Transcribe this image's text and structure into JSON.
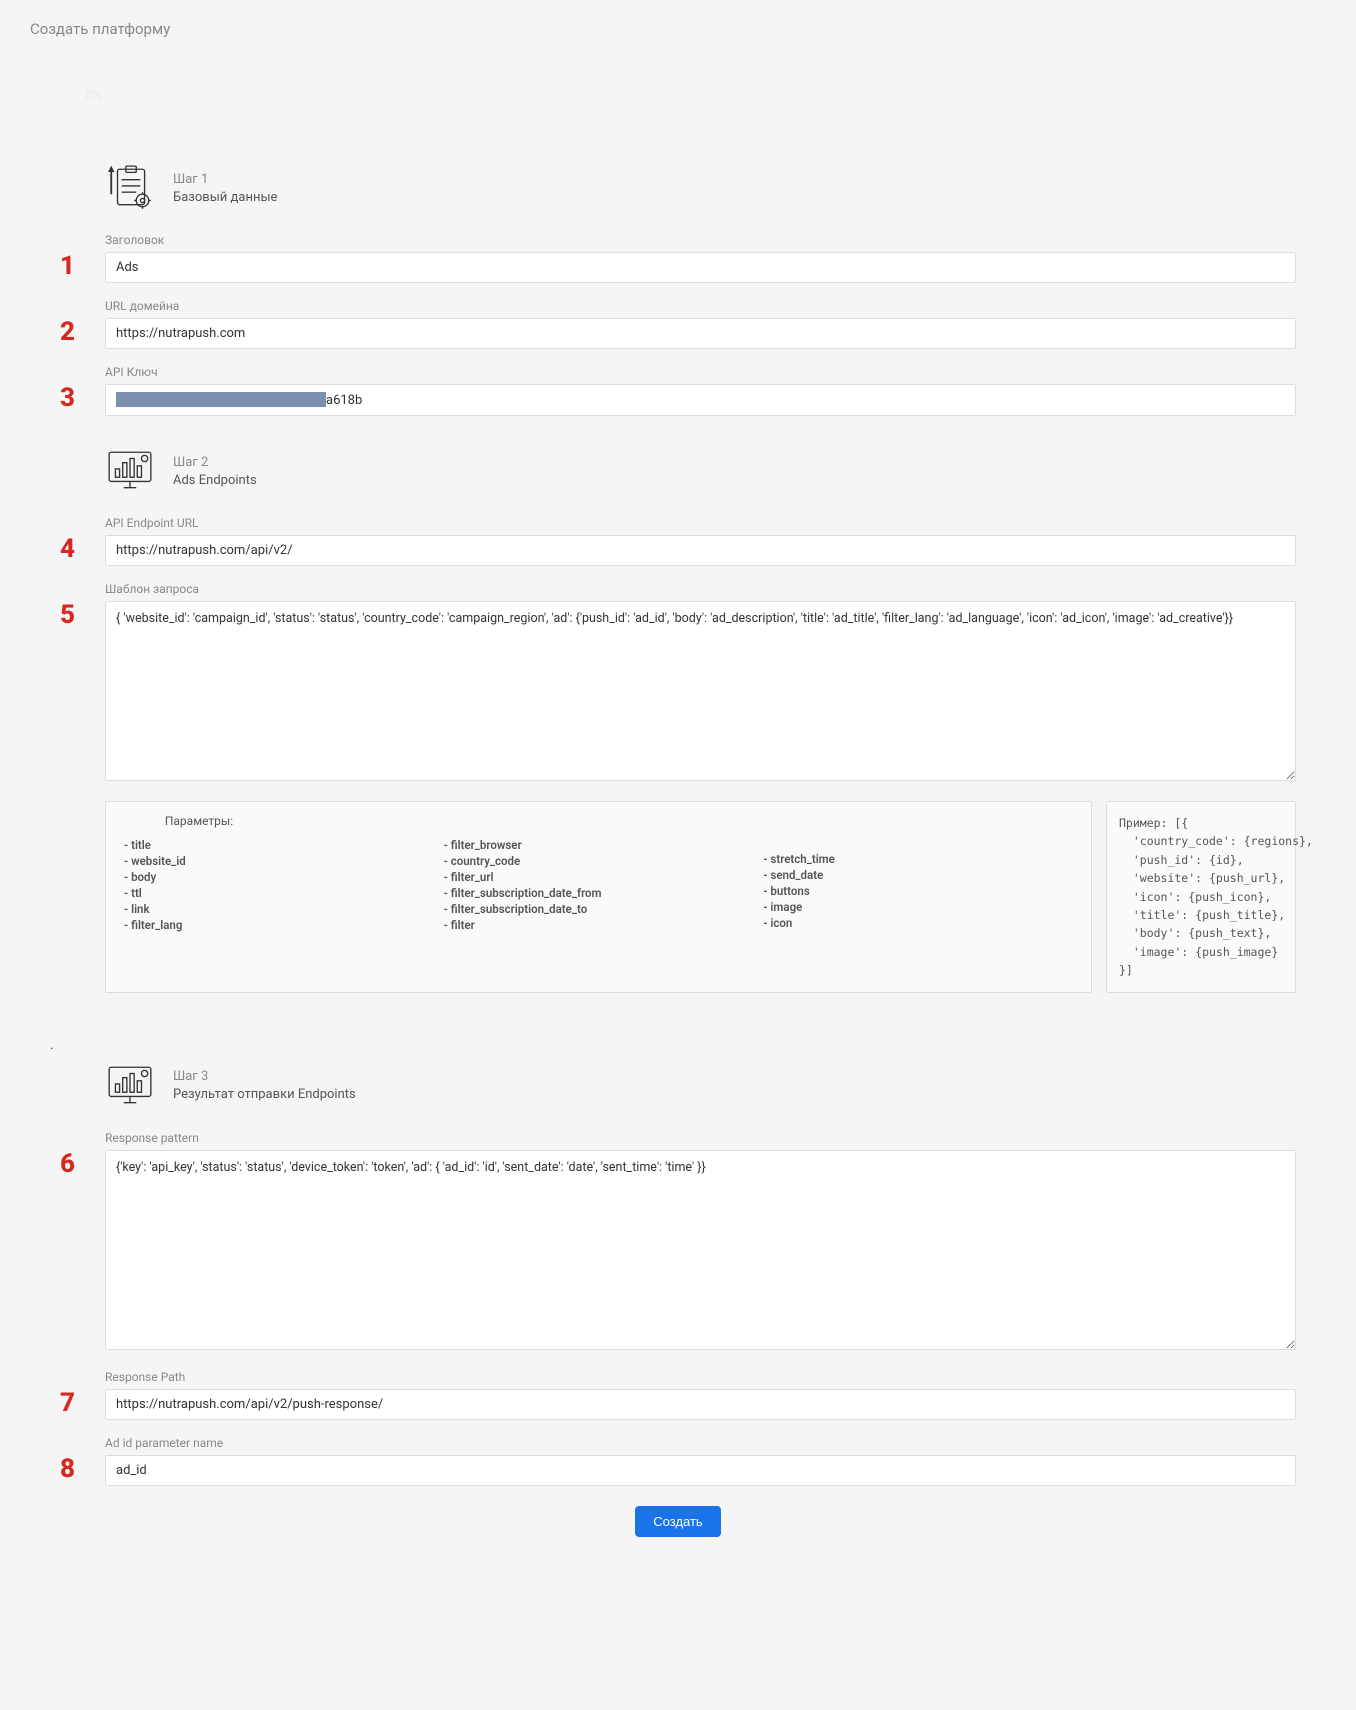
{
  "page_title": "Создать платформу",
  "progress": "0%",
  "step1": {
    "num": "Шаг 1",
    "name": "Базовый данные",
    "field1_label": "Заголовок",
    "field1_value": "Ads",
    "field2_label": "URL домейна",
    "field2_value": "https://nutrapush.com",
    "field3_label": "API Ключ",
    "field3_suffix": "a618b"
  },
  "step2": {
    "num": "Шаг 2",
    "name": "Ads Endpoints",
    "field4_label": "API Endpoint URL",
    "field4_value": "https://nutrapush.com/api/v2/",
    "field5_label": "Шаблон запроса",
    "field5_value": "{ 'website_id': 'campaign_id', 'status': 'status', 'country_code': 'campaign_region', 'ad': {'push_id': 'ad_id', 'body': 'ad_description', 'title': 'ad_title', 'filter_lang': 'ad_language', 'icon': 'ad_icon', 'image': 'ad_creative'}}",
    "params_title": "Параметры:",
    "params_col1": [
      "- title",
      "- website_id",
      "- body",
      "- ttl",
      "- link",
      "- filter_lang"
    ],
    "params_col2": [
      "- filter_browser",
      "- country_code",
      "- filter_url",
      "- filter_subscription_date_from",
      "- filter_subscription_date_to",
      "- filter"
    ],
    "params_col3": [
      "- stretch_time",
      "- send_date",
      "- buttons",
      "- image",
      "- icon"
    ],
    "example": "Пример: [{\n  'country_code': {regions},\n  'push_id': {id},\n  'website': {push_url},\n  'icon': {push_icon},\n  'title': {push_title},\n  'body': {push_text},\n  'image': {push_image}\n}]"
  },
  "step3": {
    "num": "Шаг 3",
    "name": "Результат отправки Endpoints",
    "field6_label": "Response pattern",
    "field6_value": "{'key': 'api_key', 'status': 'status', 'device_token': 'token', 'ad': { 'ad_id': 'id', 'sent_date': 'date', 'sent_time': 'time' }}",
    "field7_label": "Response Path",
    "field7_value": "https://nutrapush.com/api/v2/push-response/",
    "field8_label": "Ad id parameter name",
    "field8_value": "ad_id"
  },
  "markers": {
    "m1": "1",
    "m2": "2",
    "m3": "3",
    "m4": "4",
    "m5": "5",
    "m6": "6",
    "m7": "7",
    "m8": "8"
  },
  "submit_label": "Создать"
}
